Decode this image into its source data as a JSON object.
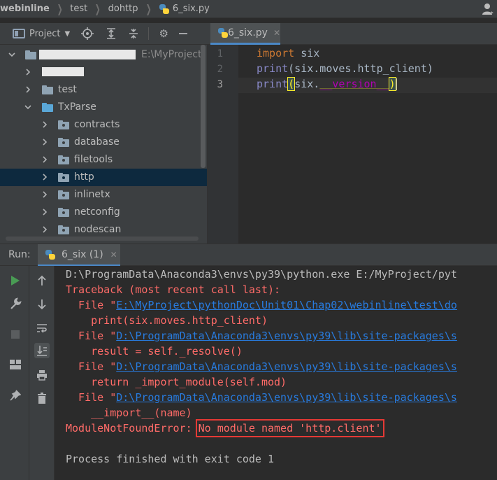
{
  "breadcrumb": {
    "items": [
      "webinline",
      "test",
      "dohttp",
      "6_six.py"
    ]
  },
  "project_panel": {
    "title": "Project",
    "root_path": "E:\\MyProject\\",
    "tree": [
      {
        "label": "test",
        "expanded": false
      },
      {
        "label": "TxParse",
        "expanded": true
      },
      {
        "label": "contracts",
        "expanded": false
      },
      {
        "label": "database",
        "expanded": false
      },
      {
        "label": "filetools",
        "expanded": false
      },
      {
        "label": "http",
        "expanded": false,
        "selected": true
      },
      {
        "label": "inlinetx",
        "expanded": false
      },
      {
        "label": "netconfig",
        "expanded": false
      },
      {
        "label": "nodescan",
        "expanded": false
      }
    ]
  },
  "editor": {
    "tab_label": "6_six.py",
    "line_numbers": [
      "1",
      "2",
      "3"
    ],
    "lines": {
      "l1_kw": "import",
      "l1_rest": " six",
      "l2_fn": "print",
      "l2_rest": "(six.moves.http_client)",
      "l3_fn": "print",
      "l3_open": "(",
      "l3_mid": "six.",
      "l3_dunder": "__version__",
      "l3_close": ")"
    }
  },
  "run_panel": {
    "label": "Run:",
    "tab_label": "6_six (1)",
    "console": [
      {
        "kind": "normal",
        "text": "D:\\ProgramData\\Anaconda3\\envs\\py39\\python.exe E:/MyProject/pyt"
      },
      {
        "kind": "err",
        "text": "Traceback (most recent call last):"
      },
      {
        "kind": "file",
        "prefix": "  File \"",
        "link": "E:\\MyProject\\pythonDoc\\Unit01\\Chap02\\webinline\\test\\do"
      },
      {
        "kind": "err",
        "text": "    print(six.moves.http_client)"
      },
      {
        "kind": "file",
        "prefix": "  File \"",
        "link": "D:\\ProgramData\\Anaconda3\\envs\\py39\\lib\\site-packages\\s"
      },
      {
        "kind": "err",
        "text": "    result = self._resolve()"
      },
      {
        "kind": "file",
        "prefix": "  File \"",
        "link": "D:\\ProgramData\\Anaconda3\\envs\\py39\\lib\\site-packages\\s"
      },
      {
        "kind": "err",
        "text": "    return _import_module(self.mod)"
      },
      {
        "kind": "file",
        "prefix": "  File \"",
        "link": "D:\\ProgramData\\Anaconda3\\envs\\py39\\lib\\site-packages\\s"
      },
      {
        "kind": "err",
        "text": "    __import__(name)"
      },
      {
        "kind": "errbox",
        "prefix": "ModuleNotFoundError: ",
        "boxed": "No module named 'http.client'"
      },
      {
        "kind": "blank",
        "text": ""
      },
      {
        "kind": "normal",
        "text": "Process finished with exit code 1"
      }
    ]
  },
  "colors": {
    "accent": "#4a88c7",
    "error_text": "#ff6b68",
    "link": "#287bde",
    "highlight_box": "#e53935",
    "selection": "#0d293e"
  }
}
